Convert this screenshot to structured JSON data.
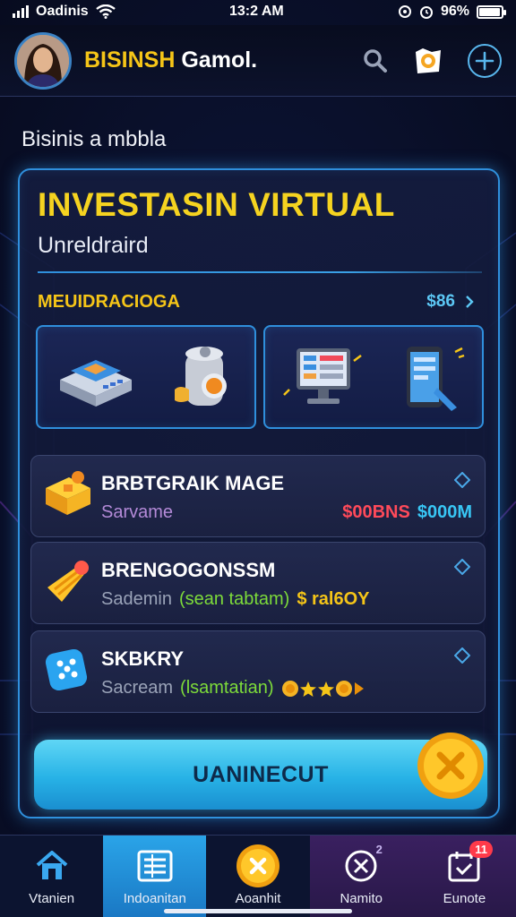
{
  "status_bar": {
    "carrier": "Oadinis",
    "time": "13:2 AM",
    "battery": "96%",
    "battery_level": 0.96
  },
  "header": {
    "title_part1": "BISINSH",
    "title_part2": "Gamol.",
    "icons": [
      "search-icon",
      "notification-icon",
      "plus-icon"
    ]
  },
  "page_heading": "Bisinis a mbbla",
  "card": {
    "title": "INVESTASIN VIRTUAL",
    "subtitle": "Unreldraird",
    "section_label": "MEUIDRACIOGA",
    "section_value": "$86"
  },
  "items": [
    {
      "name": "BRBTGRAIK MAGE",
      "sub": "Sarvame",
      "value_red": "$00BNS",
      "value_blue": "$000M",
      "icon": "crate-icon"
    },
    {
      "name": "BRENGOGONSSM",
      "sub": "Sademin",
      "sub_green": "(sean tabtam)",
      "sub_yellow": "$ ral6OY",
      "icon": "cone-icon"
    },
    {
      "name": "SKBKRY",
      "sub": "Sacream",
      "sub_green": "(lsamtatian)",
      "icon": "dice-icon"
    }
  ],
  "cta_label": "UANINECUT",
  "nav": [
    {
      "label": "Vtanien",
      "icon": "home-icon"
    },
    {
      "label": "Indoanitan",
      "icon": "list-icon"
    },
    {
      "label": "Aoanhit",
      "icon": "coin-icon"
    },
    {
      "label": "Namito",
      "icon": "cross-circle-icon",
      "badge": "2"
    },
    {
      "label": "Eunote",
      "icon": "calendar-check-icon",
      "badge": "11"
    }
  ],
  "colors": {
    "accent_yellow": "#f5c518",
    "accent_blue": "#2f8fdc",
    "cta_blue": "#27b2e6",
    "value_red": "#ff4a5a",
    "value_blue": "#38c6f4",
    "sub_green": "#7ddb3a"
  }
}
